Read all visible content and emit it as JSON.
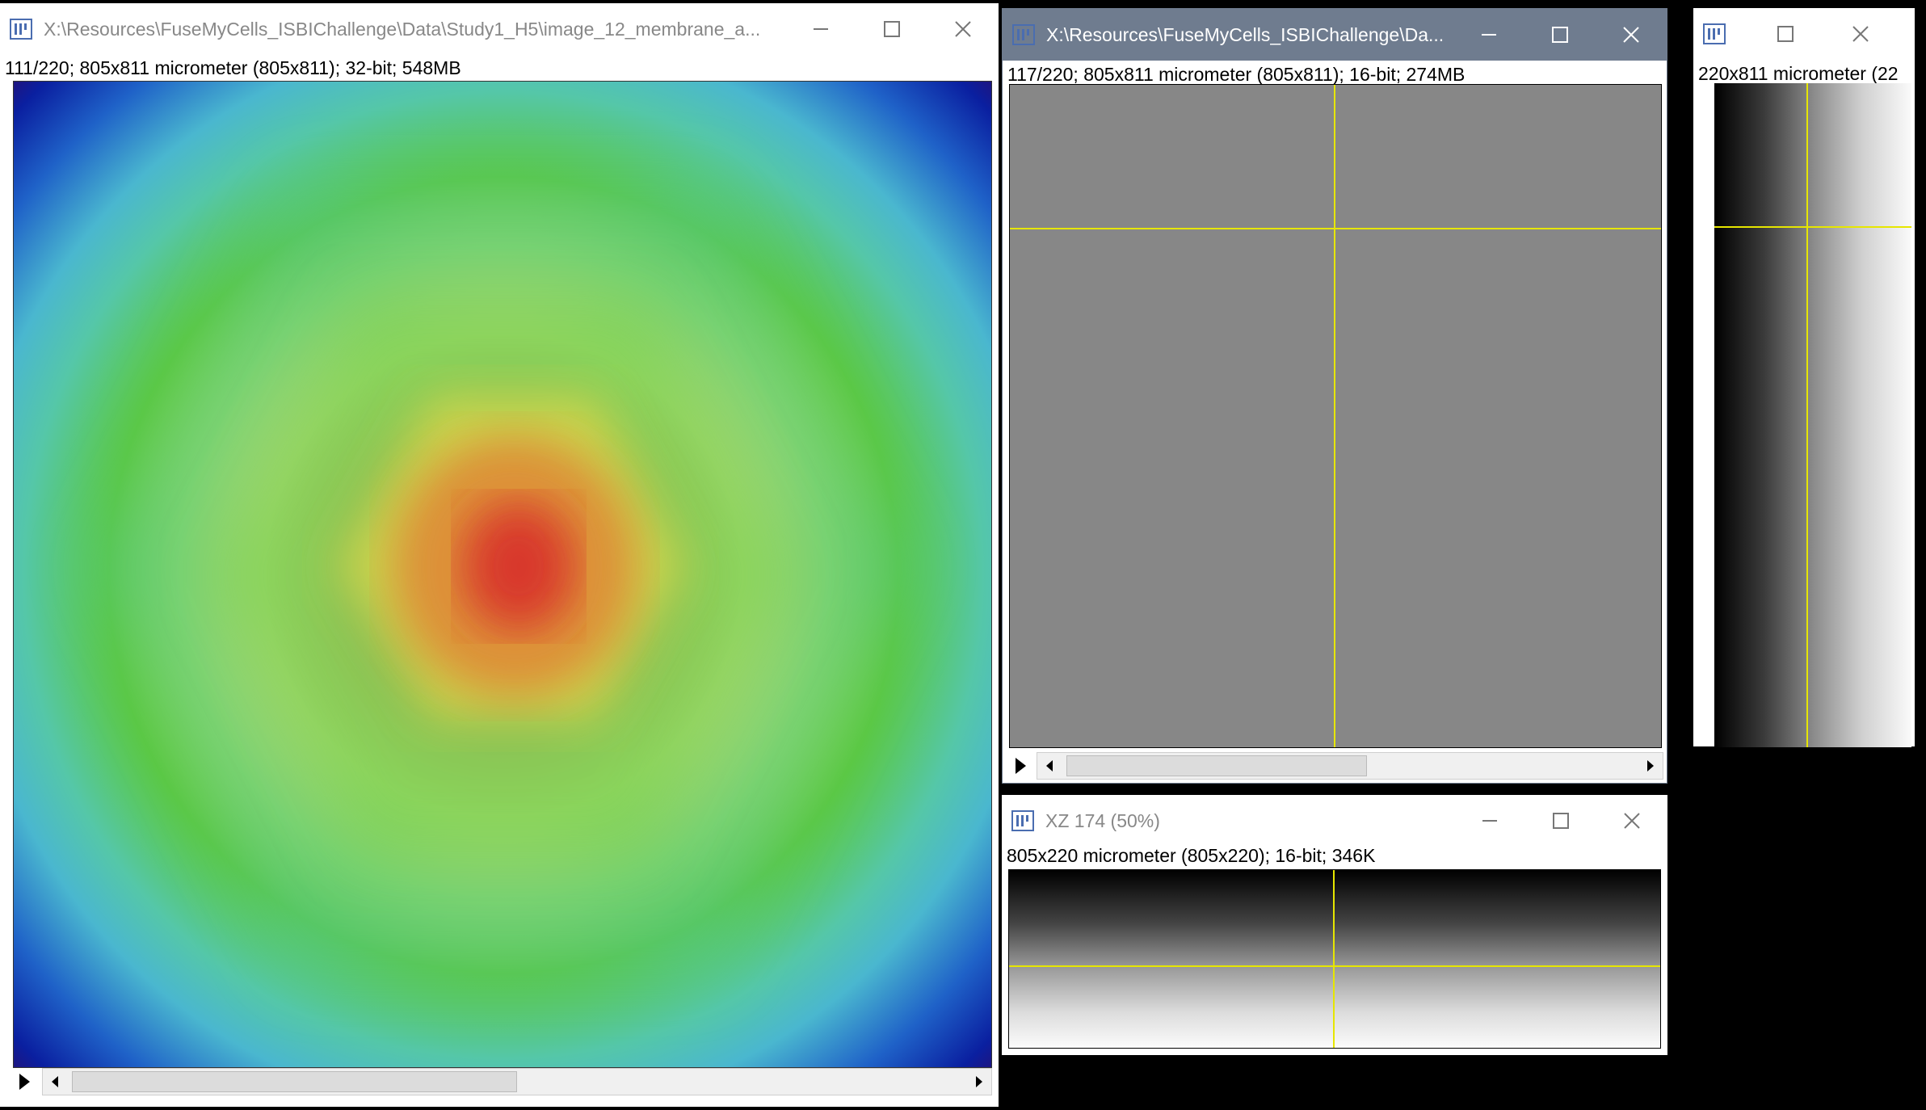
{
  "windows": {
    "main": {
      "title": "X:\\Resources\\FuseMyCells_ISBIChallenge\\Data\\Study1_H5\\image_12_membrane_a...",
      "info": "111/220; 805x811 micrometer (805x811); 32-bit; 548MB",
      "slice_position": 0.5
    },
    "ortho": {
      "title": "X:\\Resources\\FuseMyCells_ISBIChallenge\\Da...",
      "info": "117/220; 805x811 micrometer (805x811); 16-bit; 274MB",
      "slice_position": 0.53
    },
    "yz": {
      "title": "",
      "info": "220x811 micrometer (22"
    },
    "xz": {
      "title": "XZ 174 (50%)",
      "info": "805x220 micrometer (805x220); 16-bit; 346K"
    }
  },
  "icons": [
    "imagej-app-icon",
    "minimize-icon",
    "maximize-icon",
    "close-icon",
    "play-icon",
    "scroll-left-icon",
    "scroll-right-icon"
  ],
  "colors": {
    "active_titlebar": "#6f7c8f",
    "crosshair": "#e6e600",
    "gray_canvas": "#878787"
  }
}
